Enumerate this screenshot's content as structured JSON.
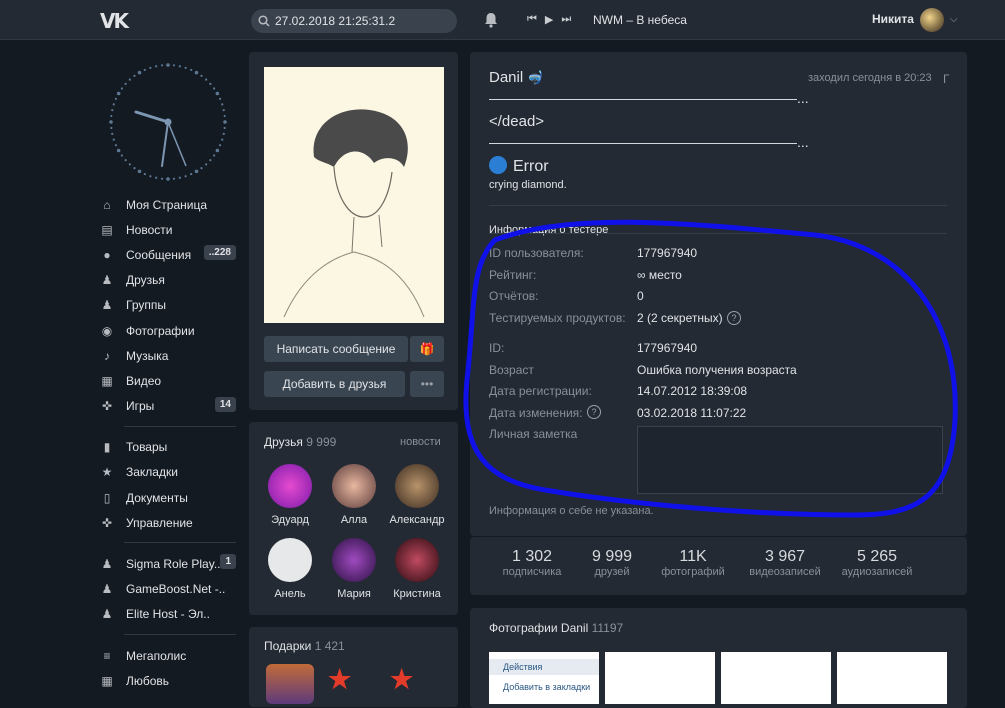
{
  "topbar": {
    "logo": "VK",
    "search": "27.02.2018 21:25:31.2",
    "track": "NWM – В небеса",
    "user": "Никита"
  },
  "sidebar": {
    "items": [
      {
        "label": "Моя Страница",
        "icon": "home-icon"
      },
      {
        "label": "Новости",
        "icon": "news-icon"
      },
      {
        "label": "Сообщения",
        "icon": "messages-icon",
        "badge": "..228"
      },
      {
        "label": "Друзья",
        "icon": "friends-icon"
      },
      {
        "label": "Группы",
        "icon": "groups-icon"
      },
      {
        "label": "Фотографии",
        "icon": "camera-icon"
      },
      {
        "label": "Музыка",
        "icon": "music-icon"
      },
      {
        "label": "Видео",
        "icon": "video-icon"
      },
      {
        "label": "Игры",
        "icon": "gamepad-icon",
        "badge": "14"
      },
      {
        "label": "Товары",
        "icon": "bag-icon"
      },
      {
        "label": "Закладки",
        "icon": "star-icon"
      },
      {
        "label": "Документы",
        "icon": "document-icon"
      },
      {
        "label": "Управление",
        "icon": "gamepad-icon"
      },
      {
        "label": "Sigma Role Play...",
        "icon": "group-icon",
        "badge": "1"
      },
      {
        "label": "GameBoost.Net -..",
        "icon": "group-icon"
      },
      {
        "label": "Elite Host - Эл..",
        "icon": "group-icon"
      },
      {
        "label": "Мегаполис",
        "icon": "stack-icon"
      },
      {
        "label": "Любовь",
        "icon": "grid-icon"
      }
    ]
  },
  "profile": {
    "name": "Danil",
    "last_seen": "заходил сегодня в 20:23",
    "status1": "——————————————————————...",
    "status2": "</dead>",
    "status3": "——————————————————————...",
    "status4": "Error",
    "status5": "crying diamond.",
    "send_message": "Написать сообщение",
    "add_friend": "Добавить в друзья",
    "info_title": "Информация о тестере",
    "rows": [
      {
        "label": "ID пользователя:",
        "value": "177967940"
      },
      {
        "label": "Рейтинг:",
        "value": "∞ место"
      },
      {
        "label": "Отчётов:",
        "value": "0"
      },
      {
        "label": "Тестируемых продуктов:",
        "value": "2 (2 секретных)"
      },
      {
        "label": "ID:",
        "value": "177967940"
      },
      {
        "label": "Возраст",
        "value": "Ошибка получения возраста"
      },
      {
        "label": "Дата регистрации:",
        "value": "14.07.2012 18:39:08"
      },
      {
        "label": "Дата изменения:",
        "value": "03.02.2018 11:07:22"
      },
      {
        "label": "Личная заметка",
        "value": ""
      }
    ],
    "about": "Информация о себе не указана."
  },
  "stats": [
    {
      "n": "1 302",
      "l": "подписчика"
    },
    {
      "n": "9 999",
      "l": "друзей"
    },
    {
      "n": "11K",
      "l": "фотографий"
    },
    {
      "n": "3 967",
      "l": "видеозаписей"
    },
    {
      "n": "5 265",
      "l": "аудиозаписей"
    }
  ],
  "friends": {
    "title": "Друзья",
    "count": "9 999",
    "link": "новости",
    "list": [
      {
        "name": "Эдуард"
      },
      {
        "name": "Алла"
      },
      {
        "name": "Александр"
      },
      {
        "name": "Анель"
      },
      {
        "name": "Мария"
      },
      {
        "name": "Кристина"
      }
    ]
  },
  "gifts": {
    "title": "Подарки",
    "count": "1 421"
  },
  "photos": {
    "title": "Фотографии Danil",
    "count": "11197",
    "menu1": "Действия",
    "menu2": "Добавить в закладки"
  }
}
